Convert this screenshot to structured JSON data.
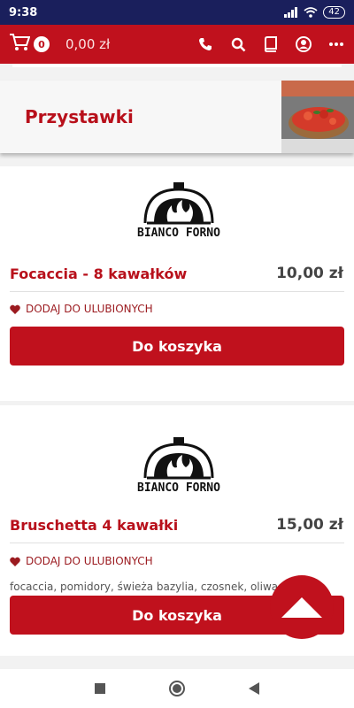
{
  "status": {
    "time": "9:38",
    "battery": "42"
  },
  "header": {
    "cart_count": "0",
    "cart_total": "0,00 zł"
  },
  "category": {
    "title": "Przystawki"
  },
  "brand": {
    "logo_text": "BIANCO FORNO"
  },
  "products": [
    {
      "name": "Focaccia - 8 kawałków",
      "price": "10,00 zł",
      "favorite_label": "DODAJ DO ULUBIONYCH",
      "button": "Do koszyka"
    },
    {
      "name": "Bruschetta 4 kawałki",
      "price": "15,00 zł",
      "favorite_label": "DODAJ DO ULUBIONYCH",
      "description": "focaccia, pomidory, świeża bazylia, czosnek, oliwa",
      "button": "Do koszyka"
    }
  ],
  "colors": {
    "primary": "#c0111d",
    "statusbar": "#1a1f5c",
    "title": "#b8101b"
  },
  "icons": [
    "cart-icon",
    "phone-icon",
    "search-icon",
    "book-icon",
    "user-icon",
    "more-icon",
    "heart-icon",
    "arrow-up-icon",
    "square-nav-icon",
    "circle-nav-icon",
    "back-nav-icon"
  ]
}
